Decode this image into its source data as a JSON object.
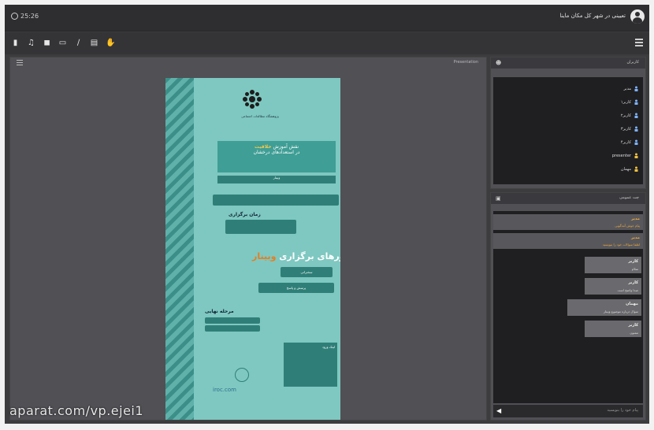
{
  "header": {
    "clock": "25:26",
    "title": "تعیینی در شهر کل مکان ماینا"
  },
  "toolbar": {
    "icons": [
      "volume-icon",
      "mic-icon",
      "camera-icon",
      "screen-share-icon",
      "pen-icon",
      "document-icon",
      "hand-icon"
    ]
  },
  "stage": {
    "label": "Presentation"
  },
  "poster": {
    "subtitle": "پژوهشگاه مطالعات اجتماعی",
    "title_line1": "نقش آموزش",
    "title_highlight": "خلاقیت",
    "title_line2": "در استعدادهای درخشان",
    "webinar_label": "وبینار",
    "time_label": "زمان برگزاری",
    "axes_title": "محورهای برگزاری",
    "axes_highlight": "وبینار",
    "axis1": "سخنرانی",
    "axis2": "پرسش و پاسخ",
    "stage_label": "مرحله نهایی",
    "info_text": "لینک ورود",
    "footer_logo": "iroc.com"
  },
  "users_panel": {
    "title": "کاربران",
    "users": [
      {
        "name": "مدیر",
        "role": "moderator"
      },
      {
        "name": "کاربر۱",
        "role": "user"
      },
      {
        "name": "کاربر۲",
        "role": "user"
      },
      {
        "name": "کاربر۳",
        "role": "user"
      },
      {
        "name": "کاربر۴",
        "role": "user"
      },
      {
        "name": "presenter",
        "role": "presenter"
      },
      {
        "name": "مهمان",
        "role": "presenter"
      }
    ]
  },
  "chat_panel": {
    "title": "چت عمومی",
    "input_placeholder": "پیام خود را بنویسید",
    "wide_messages": [
      {
        "name": "مدیر",
        "text": "پیام خوش آمدگویی"
      },
      {
        "name": "مدیر",
        "text": "لطفا سوالات خود را بنویسید"
      }
    ],
    "bubbles": [
      {
        "name": "کاربر",
        "text": "سلام"
      },
      {
        "name": "کاربر",
        "text": "صدا واضح است"
      },
      {
        "name": "مهمان",
        "text": "سوال درباره موضوع وبینار"
      },
      {
        "name": "کاربر",
        "text": "ممنون"
      }
    ]
  },
  "watermark": "aparat.com/vp.ejei1"
}
